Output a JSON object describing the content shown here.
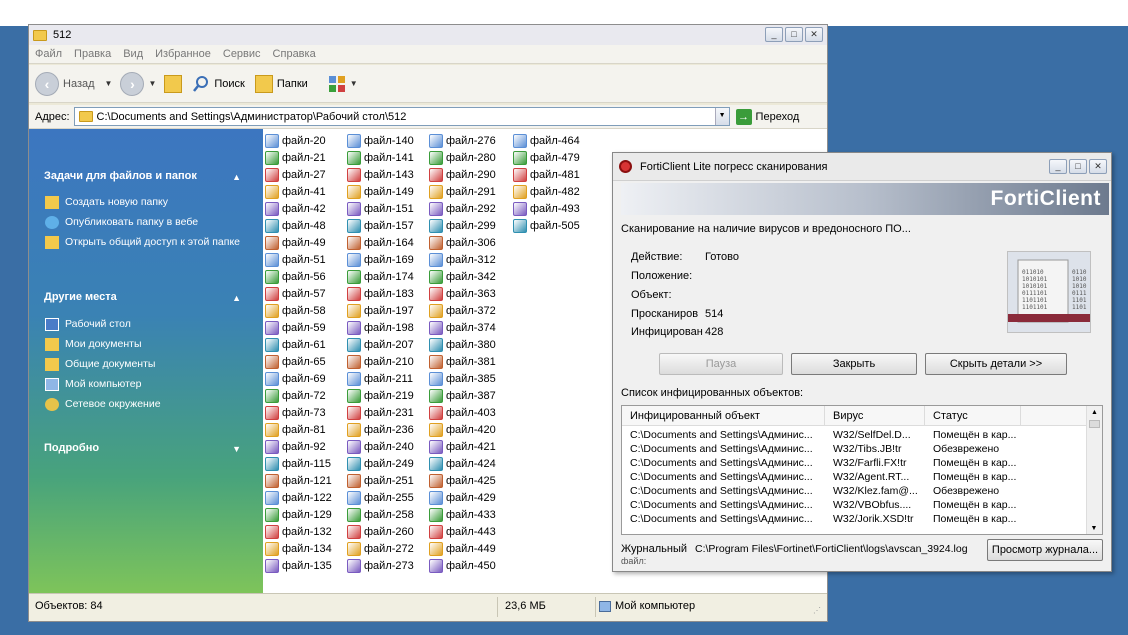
{
  "explorer": {
    "title": "512",
    "menu": [
      "Файл",
      "Правка",
      "Вид",
      "Избранное",
      "Сервис",
      "Справка"
    ],
    "toolbar": {
      "back": "Назад",
      "search": "Поиск",
      "folders": "Папки"
    },
    "address": {
      "label": "Адрес:",
      "path": "C:\\Documents and Settings\\Администратор\\Рабочий стол\\512",
      "go": "Переход"
    },
    "taskpane": {
      "tasks_title": "Задачи для файлов и папок",
      "tasks": [
        {
          "label": "Создать новую папку",
          "icon": "new-folder-icon"
        },
        {
          "label": "Опубликовать папку в вебе",
          "icon": "web-publish-icon"
        },
        {
          "label": "Открыть общий доступ к этой папке",
          "icon": "share-icon"
        }
      ],
      "places_title": "Другие места",
      "places": [
        {
          "label": "Рабочий стол",
          "icon": "desktop-icon"
        },
        {
          "label": "Мои документы",
          "icon": "folder-icon"
        },
        {
          "label": "Общие документы",
          "icon": "folder-icon"
        },
        {
          "label": "Мой компьютер",
          "icon": "computer-icon"
        },
        {
          "label": "Сетевое окружение",
          "icon": "network-icon"
        }
      ],
      "details_title": "Подробно"
    },
    "files": [
      [
        "файл-20",
        "файл-21",
        "файл-27",
        "файл-41",
        "файл-42",
        "файл-48",
        "файл-49",
        "файл-51",
        "файл-56",
        "файл-57",
        "файл-58",
        "файл-59",
        "файл-61",
        "файл-65",
        "файл-69",
        "файл-72",
        "файл-73",
        "файл-81",
        "файл-92",
        "файл-115",
        "файл-121",
        "файл-122",
        "файл-129",
        "файл-132",
        "файл-134",
        "файл-135"
      ],
      [
        "файл-140",
        "файл-141",
        "файл-143",
        "файл-149",
        "файл-151",
        "файл-157",
        "файл-164",
        "файл-169",
        "файл-174",
        "файл-183",
        "файл-197",
        "файл-198",
        "файл-207",
        "файл-210",
        "файл-211",
        "файл-219",
        "файл-231",
        "файл-236",
        "файл-240",
        "файл-249",
        "файл-251",
        "файл-255",
        "файл-258",
        "файл-260",
        "файл-272",
        "файл-273"
      ],
      [
        "файл-276",
        "файл-280",
        "файл-290",
        "файл-291",
        "файл-292",
        "файл-299",
        "файл-306",
        "файл-312",
        "файл-342",
        "файл-363",
        "файл-372",
        "файл-374",
        "файл-380",
        "файл-381",
        "файл-385",
        "файл-387",
        "файл-403",
        "файл-420",
        "файл-421",
        "файл-424",
        "файл-425",
        "файл-429",
        "файл-433",
        "файл-443",
        "файл-449",
        "файл-450"
      ],
      [
        "файл-464",
        "файл-479",
        "файл-481",
        "файл-482",
        "файл-493",
        "файл-505"
      ]
    ],
    "status": {
      "objects": "Объектов: 84",
      "size": "23,6 МБ",
      "location": "Мой компьютер"
    }
  },
  "forti": {
    "title": "FortiClient Lite погресс сканирования",
    "brand": "FortiClient",
    "scan_text": "Сканирование на наличие вирусов и вредоносного ПО...",
    "action_label": "Действие:",
    "action_value": "Готово",
    "location_label": "Положение:",
    "object_label": "Объект:",
    "scanned_label": "Просканиров",
    "scanned_value": "514",
    "infected_label": "Инфицирован",
    "infected_value": "428",
    "buttons": {
      "pause": "Пауза",
      "close": "Закрыть",
      "hide": "Скрыть детали >>"
    },
    "list_title": "Список инфицированных объектов:",
    "columns": [
      "Инфицированный объект",
      "Вирус",
      "Статус"
    ],
    "rows": [
      [
        "C:\\Documents and Settings\\Админис...",
        "W32/SelfDel.D...",
        "Помещён в кар..."
      ],
      [
        "C:\\Documents and Settings\\Админис...",
        "W32/Tibs.JB!tr",
        "Обезврежено"
      ],
      [
        "C:\\Documents and Settings\\Админис...",
        "W32/Farfli.FX!tr",
        "Помещён в кар..."
      ],
      [
        "C:\\Documents and Settings\\Админис...",
        "W32/Agent.RT...",
        "Помещён в кар..."
      ],
      [
        "C:\\Documents and Settings\\Админис...",
        "W32/Klez.fam@...",
        "Обезврежено"
      ],
      [
        "C:\\Documents and Settings\\Админис...",
        "W32/VBObfus....",
        "Помещён в кар..."
      ],
      [
        "C:\\Documents and Settings\\Админис...",
        "W32/Jorik.XSD!tr",
        "Помещён в кар..."
      ]
    ],
    "log_label": "Журнальный",
    "log_path": "C:\\Program Files\\Fortinet\\FortiClient\\logs\\avscan_3924.log",
    "log_sub": "файл:",
    "view_log": "Просмотр журнала..."
  },
  "colors": {
    "desktop": "#3a6ea5",
    "taskpane_top": "#3c76c0",
    "taskpane_bottom": "#7ec45a"
  }
}
